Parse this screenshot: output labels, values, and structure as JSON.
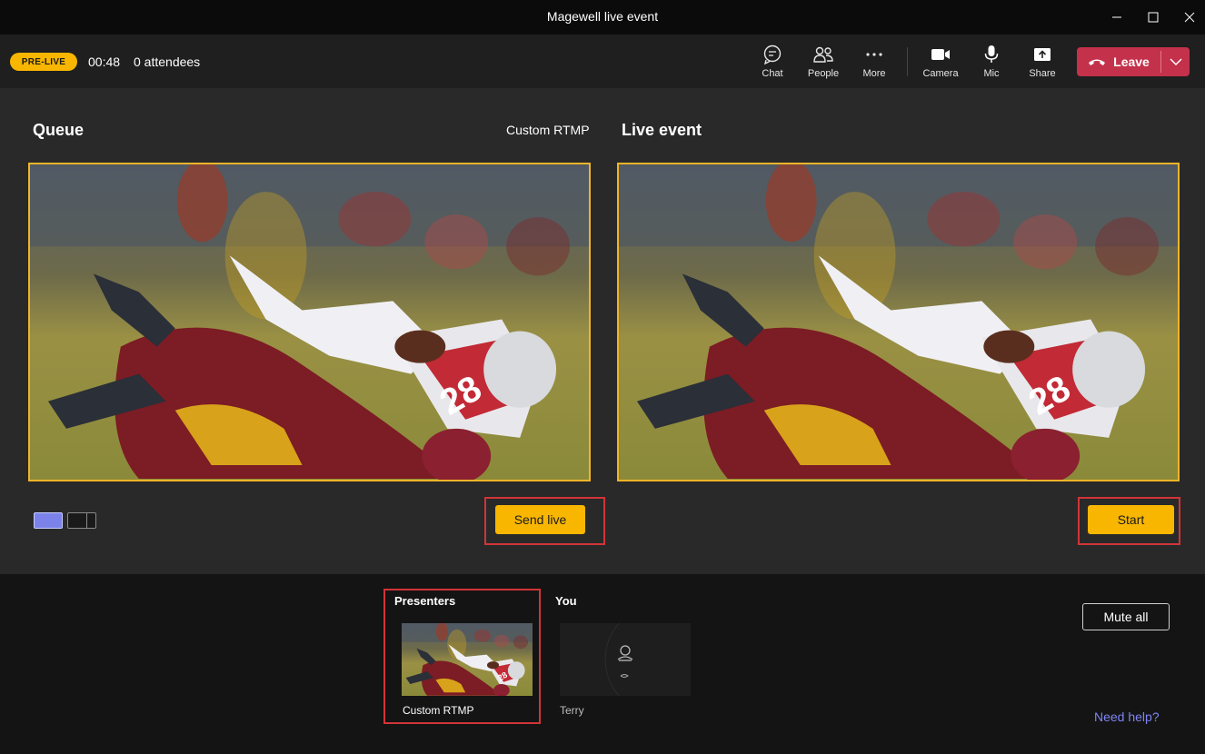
{
  "window": {
    "title": "Magewell live event"
  },
  "toolbar": {
    "status_badge": "PRE-LIVE",
    "timer": "00:48",
    "attendees": "0 attendees",
    "buttons": [
      {
        "label": "Chat",
        "icon": "chat-icon"
      },
      {
        "label": "People",
        "icon": "people-icon"
      },
      {
        "label": "More",
        "icon": "more-icon"
      },
      {
        "label": "Camera",
        "icon": "camera-icon"
      },
      {
        "label": "Mic",
        "icon": "mic-icon"
      },
      {
        "label": "Share",
        "icon": "share-icon"
      }
    ],
    "leave_label": "Leave"
  },
  "queue": {
    "title": "Queue",
    "source_label": "Custom RTMP",
    "send_live_label": "Send live"
  },
  "live_event": {
    "title": "Live event",
    "start_label": "Start"
  },
  "presenters": {
    "title": "Presenters",
    "items": [
      {
        "name": "Custom RTMP"
      }
    ]
  },
  "you": {
    "title": "You",
    "name": "Terry"
  },
  "mute_all_label": "Mute all",
  "help_link": "Need help?",
  "colors": {
    "accent_yellow": "#f8b600",
    "leave_red": "#c4314b",
    "highlight_red": "#d13438",
    "link_purple": "#7f85f5",
    "layout_selected": "#7b83eb"
  }
}
